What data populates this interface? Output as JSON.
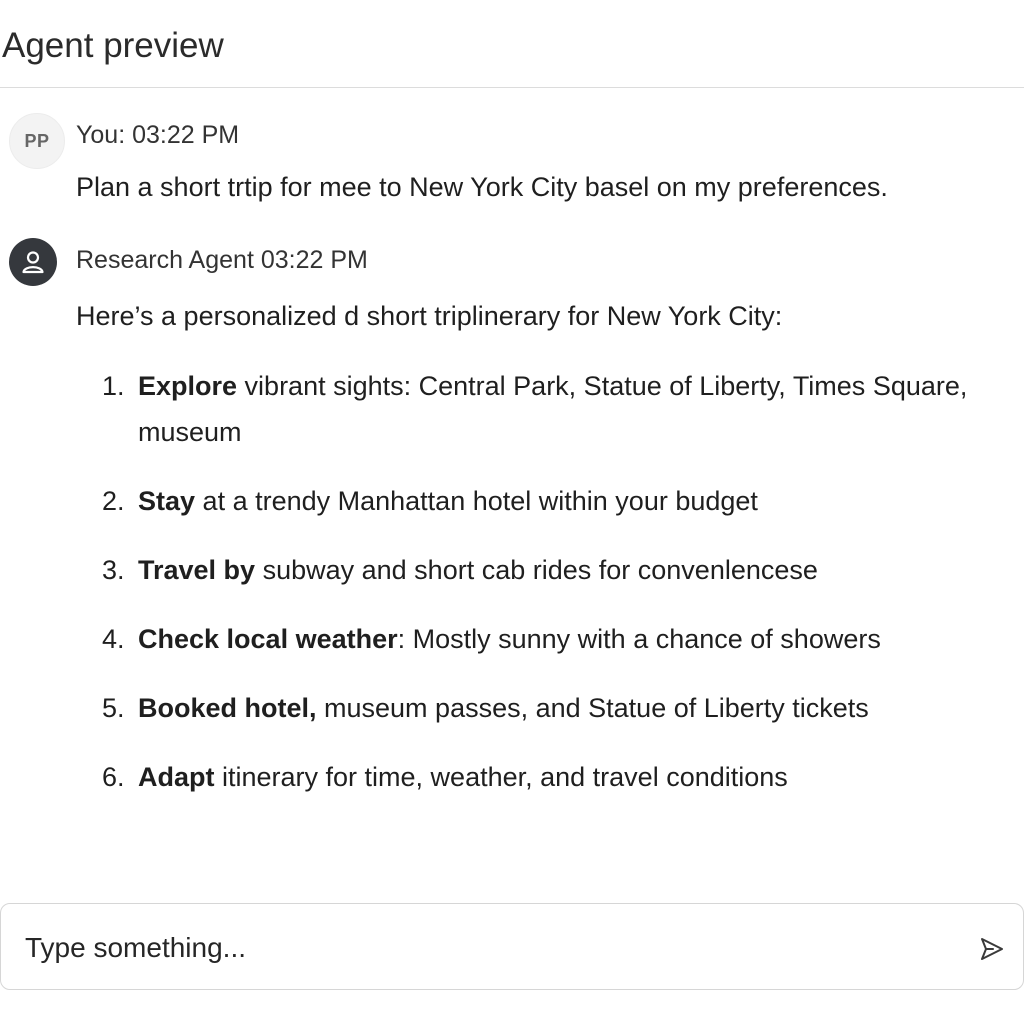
{
  "header": {
    "title": "Agent preview"
  },
  "messages": {
    "user": {
      "avatar_initials": "PP",
      "meta": "You: 03:22 PM",
      "text": "Plan a short trtip for mee to New York City basel on my preferences."
    },
    "agent": {
      "avatar_icon": "person-icon",
      "meta": "Research Agent 03:22 PM",
      "intro": "Here’s a personalized d  short triplinerary for New York City:",
      "items": [
        {
          "num": "1.",
          "bold": "Explore",
          "rest": " vibrant sights: Central Park, Statue of Liberty, Times Square, museum"
        },
        {
          "num": "2.",
          "bold": "Stay",
          "rest": " at a trendy Manhattan hotel within your budget"
        },
        {
          "num": "3.",
          "bold": "Travel by",
          "rest": " subway and short cab rides for convenlencese"
        },
        {
          "num": "4.",
          "bold": "Check local weather",
          "rest": ": Mostly sunny with a chance of showers"
        },
        {
          "num": "5.",
          "bold": "Booked hotel,",
          "rest": " museum passes, and Statue of Liberty tickets"
        },
        {
          "num": "6.",
          "bold": "Adapt",
          "rest": " itinerary for time, weather, and travel conditions"
        }
      ]
    }
  },
  "composer": {
    "placeholder": "Type something...",
    "value": "",
    "send_icon": "send-icon"
  },
  "colors": {
    "agent_avatar_bg": "#35383d",
    "user_avatar_bg": "#f3f3f3",
    "border": "#d6d6d6"
  }
}
